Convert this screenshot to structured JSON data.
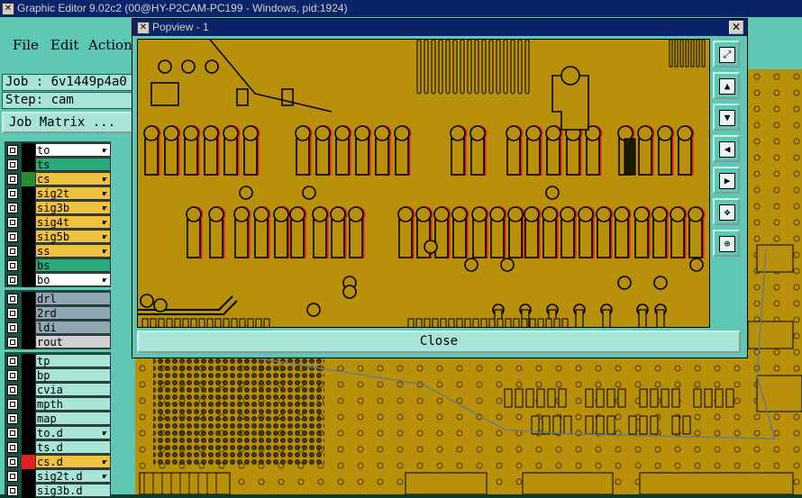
{
  "main_window": {
    "title": "Graphic Editor 9.02c2 (00@HY-P2CAM-PC199 - Windows, pid:1924)"
  },
  "menu": {
    "file": "File",
    "edit": "Edit",
    "actions": "Actions"
  },
  "job": {
    "label": "Job : 6v1449p4a0",
    "step": "Step: cam",
    "matrix_button": "Job Matrix ..."
  },
  "layers": {
    "board": [
      {
        "name": "to",
        "color": "#ffffff",
        "swatch": "#000000",
        "icon": "hand"
      },
      {
        "name": "ts",
        "color": "#2aa87a",
        "swatch": "#000000",
        "icon": ""
      },
      {
        "name": "cs",
        "color": "#f0c040",
        "swatch": "#2a8a30",
        "icon": "hand"
      },
      {
        "name": "sig2t",
        "color": "#f0c040",
        "swatch": "#000000",
        "icon": "hand"
      },
      {
        "name": "sig3b",
        "color": "#f0c040",
        "swatch": "#000000",
        "icon": "hand"
      },
      {
        "name": "sig4t",
        "color": "#f0c040",
        "swatch": "#000000",
        "icon": "hand"
      },
      {
        "name": "sig5b",
        "color": "#f0c040",
        "swatch": "#000000",
        "icon": "hand"
      },
      {
        "name": "ss",
        "color": "#f0c040",
        "swatch": "#000000",
        "icon": "hand"
      },
      {
        "name": "bs",
        "color": "#2aa87a",
        "swatch": "#000000",
        "icon": ""
      },
      {
        "name": "bo",
        "color": "#ffffff",
        "swatch": "#000000",
        "icon": "hand"
      }
    ],
    "drill": [
      {
        "name": "drl",
        "color": "#8fa8b4",
        "swatch": "#000000",
        "icon": ""
      },
      {
        "name": "2rd",
        "color": "#8fa8b4",
        "swatch": "#000000",
        "icon": ""
      },
      {
        "name": "ldi",
        "color": "#8fa8b4",
        "swatch": "#000000",
        "icon": ""
      },
      {
        "name": "rout",
        "color": "#d0d0d0",
        "swatch": "#000000",
        "icon": ""
      }
    ],
    "misc": [
      {
        "name": "tp",
        "color": "#a8e4d8",
        "swatch": "#000000",
        "icon": ""
      },
      {
        "name": "bp",
        "color": "#a8e4d8",
        "swatch": "#000000",
        "icon": ""
      },
      {
        "name": "cvia",
        "color": "#a8e4d8",
        "swatch": "#000000",
        "icon": ""
      },
      {
        "name": "mpth",
        "color": "#a8e4d8",
        "swatch": "#000000",
        "icon": ""
      },
      {
        "name": "map",
        "color": "#a8e4d8",
        "swatch": "#000000",
        "icon": ""
      },
      {
        "name": "to.d",
        "color": "#a8e4d8",
        "swatch": "#000000",
        "icon": "hand"
      },
      {
        "name": "ts.d",
        "color": "#a8e4d8",
        "swatch": "#000000",
        "icon": ""
      },
      {
        "name": "cs.d",
        "color": "#f0c040",
        "swatch": "#e02020",
        "icon": "hand"
      },
      {
        "name": "sig2t.d",
        "color": "#a8e4d8",
        "swatch": "#000000",
        "icon": "hand"
      },
      {
        "name": "sig3b.d",
        "color": "#a8e4d8",
        "swatch": "#000000",
        "icon": ""
      }
    ]
  },
  "popup": {
    "title": "Popview - 1",
    "close_label": "Close",
    "close_x": "✕"
  },
  "popup_tools": [
    "zoom-fit-icon",
    "pan-up-icon",
    "pan-down-icon",
    "pan-left-icon",
    "pan-right-icon",
    "zoom-in-icon",
    "zoom-out-icon"
  ],
  "colors": {
    "pcb_bg": "#b8900a",
    "pad": "#b8900a",
    "outline": "#000000",
    "highlight": "#e02020",
    "panel": "#5ec8b4"
  }
}
